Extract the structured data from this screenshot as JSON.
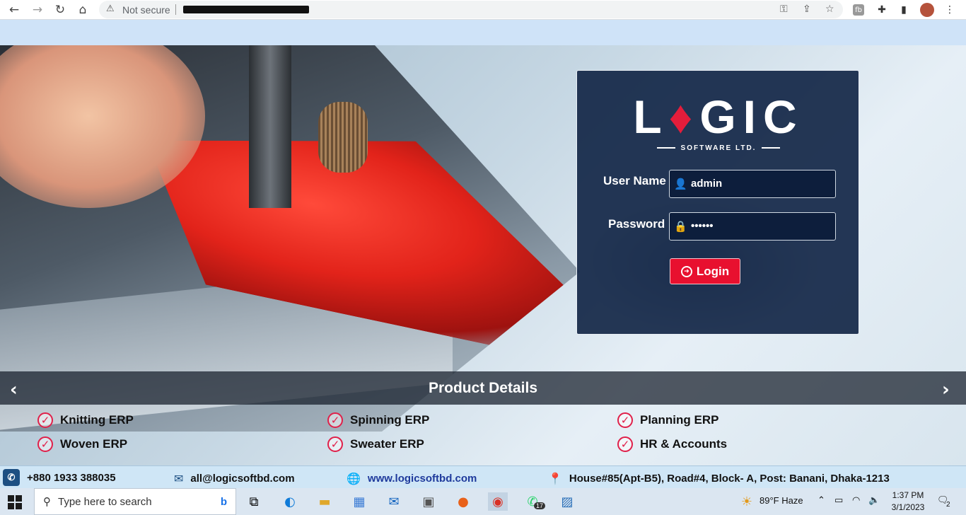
{
  "browser": {
    "security_label": "Not secure",
    "nav": {
      "back": "←",
      "forward": "→",
      "reload": "↻",
      "home": "⌂"
    },
    "omni_icons": {
      "key": "⚿",
      "share": "⇪",
      "star": "☆"
    },
    "extensions": {
      "fb": "fb",
      "puzzle": "✚",
      "sidepanel": "▮",
      "menu": "⋮"
    }
  },
  "login": {
    "logo_parts": [
      "L",
      "♦",
      "G",
      "I",
      "C"
    ],
    "logo_sub": "SOFTWARE LTD.",
    "username_label": "User Name",
    "username_value": "admin",
    "password_label": "Password",
    "password_value": "••••••",
    "login_button": "Login"
  },
  "products": {
    "title": "Product Details",
    "prev": "‹",
    "next": "›",
    "items": [
      "Knitting ERP",
      "Spinning ERP",
      "Planning ERP",
      "Woven ERP",
      "Sweater ERP",
      "HR & Accounts"
    ]
  },
  "contact": {
    "phone": "+880 1933 388035",
    "email": "all@logicsoftbd.com",
    "website": "www.logicsoftbd.com",
    "address": "House#85(Apt-B5), Road#4, Block- A, Post: Banani, Dhaka-1213"
  },
  "taskbar": {
    "search_placeholder": "Type here to search",
    "whatsapp_badge": "17",
    "weather": "89°F  Haze",
    "time": "1:37 PM",
    "date": "3/1/2023",
    "notifications": "2"
  },
  "colors": {
    "accent": "#e8102f",
    "card": "#122646",
    "footer": "#cfe6f6"
  }
}
